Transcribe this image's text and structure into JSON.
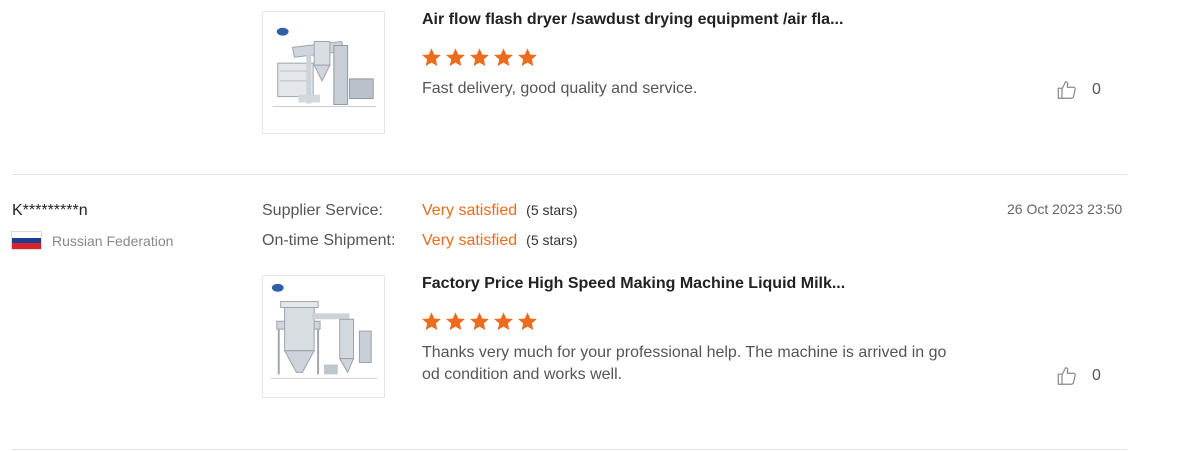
{
  "colors": {
    "accent": "#ec6b1c",
    "divider": "#e3e3e3"
  },
  "reviews": [
    {
      "product_title": "Air flow flash dryer /sawdust drying equipment /air fla...",
      "product_image_icon": "flash-dryer-machine-image",
      "star_rating": 5,
      "comment": "Fast delivery, good quality and service.",
      "like_icon": "thumbs-up-icon",
      "like_count": "0"
    },
    {
      "reviewer_name": "K*********n",
      "country": "Russian Federation",
      "country_flag": "russia-flag-icon",
      "date": "26 Oct 2023 23:50",
      "ratings": [
        {
          "label": "Supplier Service:",
          "value": "Very satisfied",
          "stars": "(5 stars)"
        },
        {
          "label": "On-time Shipment:",
          "value": "Very satisfied",
          "stars": "(5 stars)"
        }
      ],
      "product_title": "Factory Price High Speed Making Machine Liquid Milk...",
      "product_image_icon": "spray-dryer-machine-image",
      "star_rating": 5,
      "comment": "Thanks very much for your professional help. The machine is arrived in good condition and works well.",
      "comment_line1": "Thanks very much for your professional help. The machine is arrived in go",
      "comment_line2": "od condition and works well.",
      "like_icon": "thumbs-up-icon",
      "like_count": "0"
    }
  ]
}
